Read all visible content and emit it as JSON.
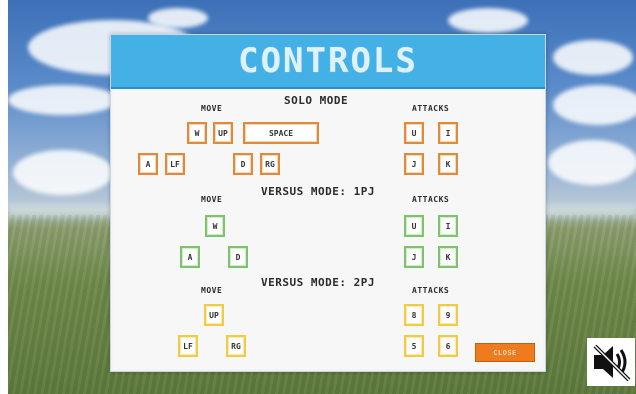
{
  "dialog": {
    "title": "CONTROLS",
    "close_label": "CLOSE"
  },
  "solo": {
    "heading": "SOLO MODE",
    "move_label": "MOVE",
    "attacks_label": "ATTACKS",
    "move_keys_row1": [
      "W",
      "UP",
      "SPACE"
    ],
    "move_keys_row2": [
      "A",
      "LF",
      "D",
      "RG"
    ],
    "attack_keys": [
      "U",
      "I",
      "J",
      "K"
    ]
  },
  "versus_1p": {
    "heading": "VERSUS MODE: 1PJ",
    "move_label": "MOVE",
    "attacks_label": "ATTACKS",
    "move_keys": [
      "W",
      "A",
      "D"
    ],
    "attack_keys": [
      "U",
      "I",
      "J",
      "K"
    ]
  },
  "versus_2p": {
    "heading": "VERSUS MODE: 2PJ",
    "move_label": "MOVE",
    "attacks_label": "ATTACKS",
    "move_keys": [
      "UP",
      "LF",
      "RG"
    ],
    "attack_keys": [
      "8",
      "9",
      "5",
      "6"
    ]
  },
  "icons": {
    "sound": "sound-muted-icon"
  },
  "colors": {
    "header": "#43b0e6",
    "solo_key_border": "#e08a3c",
    "versus1_key_border": "#7cc36b",
    "versus2_key_border": "#f0cc45",
    "close_button": "#ee7b1e"
  }
}
